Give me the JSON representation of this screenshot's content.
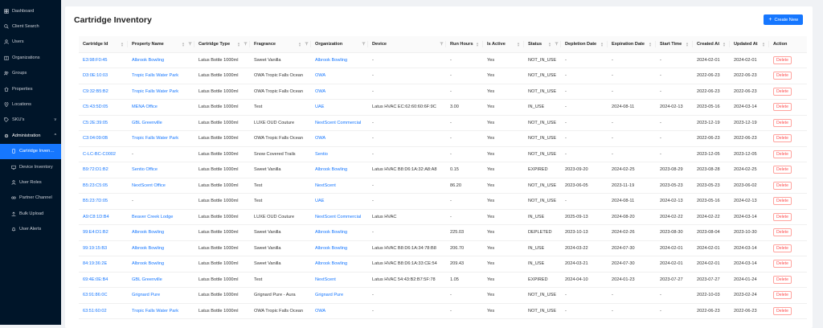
{
  "sidebar": {
    "items": [
      {
        "label": "Dashboard",
        "icon": "dashboard-icon"
      },
      {
        "label": "Client Search",
        "icon": "search-icon"
      },
      {
        "label": "Users",
        "icon": "user-icon"
      },
      {
        "label": "Organizations",
        "icon": "organization-icon"
      },
      {
        "label": "Groups",
        "icon": "group-icon"
      },
      {
        "label": "Properties",
        "icon": "home-icon"
      },
      {
        "label": "Locations",
        "icon": "location-icon"
      },
      {
        "label": "SKU's",
        "icon": "tag-icon"
      }
    ],
    "admin": {
      "label": "Administration",
      "icon": "settings-icon"
    },
    "admin_items": [
      {
        "label": "Cartridge Inven…",
        "icon": "cartridge-icon",
        "active": true
      },
      {
        "label": "Device Inventory",
        "icon": "device-icon"
      },
      {
        "label": "User Roles",
        "icon": "roles-icon"
      },
      {
        "label": "Partner Channel",
        "icon": "partner-icon"
      },
      {
        "label": "Bulk Upload",
        "icon": "upload-icon"
      },
      {
        "label": "User Alerts",
        "icon": "bell-icon"
      }
    ]
  },
  "page": {
    "title": "Cartridge Inventory",
    "create_label": "Create New"
  },
  "table": {
    "columns": [
      "Cartridge Id",
      "Property Name",
      "Cartridge Type",
      "Fragrance",
      "Organization",
      "Device",
      "Run Hours",
      "Is Active",
      "Status",
      "Depletion Date",
      "Expiration Date",
      "Start Time",
      "Created At",
      "Updated At",
      "Action"
    ],
    "delete_label": "Delete",
    "rows": [
      [
        "E3:98:F0:45",
        "Albrook Bowling",
        "Latus Bottle 1000ml",
        "Sweet Vanilla",
        "Albrook Bowling",
        "-",
        "-",
        "Yes",
        "NOT_IN_USE",
        "-",
        "-",
        "-",
        "2024-02-01",
        "2024-02-01"
      ],
      [
        "D3:0E:10:03",
        "Tropic Falls Water Park",
        "Latus Bottle 1000ml",
        "OWA Tropic Falls Ocean",
        "OWA",
        "-",
        "-",
        "Yes",
        "NOT_IN_USE",
        "-",
        "-",
        "-",
        "2022-06-23",
        "2022-06-23"
      ],
      [
        "C9:32:B5:B2",
        "Tropic Falls Water Park",
        "Latus Bottle 1000ml",
        "OWA Tropic Falls Ocean",
        "OWA",
        "-",
        "-",
        "Yes",
        "NOT_IN_USE",
        "-",
        "-",
        "-",
        "2022-06-23",
        "2022-06-23"
      ],
      [
        "C5:43:5D:05",
        "MENA Office",
        "Latus Bottle 1000ml",
        "Test",
        "UAE",
        "Latus HVAC EC:62:60:60:6F:9C",
        "3.00",
        "Yes",
        "IN_USE",
        "-",
        "2024-08-11",
        "2024-02-13",
        "2023-05-16",
        "2024-03-14"
      ],
      [
        "C5:2E:39:05",
        "GBL Greenville",
        "Latus Bottle 1000ml",
        "LUXE OUD Couture",
        "NextScent Commercial",
        "-",
        "-",
        "Yes",
        "NOT_IN_USE",
        "-",
        "-",
        "-",
        "2023-12-19",
        "2023-12-19"
      ],
      [
        "C3:04:09:0B",
        "Tropic Falls Water Park",
        "Latus Bottle 1000ml",
        "OWA Tropic Falls Ocean",
        "OWA",
        "-",
        "-",
        "Yes",
        "NOT_IN_USE",
        "-",
        "-",
        "-",
        "2022-06-23",
        "2022-06-23"
      ],
      [
        "C-LC-BC-C0002",
        "-",
        "Latus Bottle 1000ml",
        "Snow Covered Trails",
        "Sentio",
        "-",
        "-",
        "Yes",
        "NOT_IN_USE",
        "-",
        "-",
        "-",
        "2023-12-05",
        "2023-12-05"
      ],
      [
        "B9:72:D1:B2",
        "Sentio Office",
        "Latus Bottle 1000ml",
        "Sweet Vanilla",
        "Albrook Bowling",
        "Latus HVAC B8:D6:1A:32:A8:A8",
        "0.15",
        "Yes",
        "EXPIRED",
        "2023-09-20",
        "2024-02-25",
        "2023-08-29",
        "2023-08-28",
        "2024-02-25"
      ],
      [
        "B5:23:C5:05",
        "NextScent Office",
        "Latus Bottle 1000ml",
        "Test",
        "NextScent",
        "-",
        "86.20",
        "Yes",
        "NOT_IN_USE",
        "2023-06-05",
        "2023-11-19",
        "2023-05-23",
        "2023-05-23",
        "2023-06-02"
      ],
      [
        "B5:23:7D:05",
        "-",
        "Latus Bottle 1000ml",
        "Test",
        "UAE",
        "-",
        "-",
        "Yes",
        "NOT_IN_USE",
        "-",
        "2024-08-11",
        "2024-02-13",
        "2023-05-16",
        "2024-02-13"
      ],
      [
        "A9:C8:1D:B4",
        "Beaver Creek Lodge",
        "Latus Bottle 1000ml",
        "LUXE OUD Couture",
        "NextScent Commercial",
        "Latus HVAC",
        "-",
        "Yes",
        "IN_USE",
        "2025-09-13",
        "2024-08-20",
        "2024-02-22",
        "2024-02-22",
        "2024-03-14"
      ],
      [
        "99:E4:D1:B2",
        "Albrook Bowling",
        "Latus Bottle 1000ml",
        "Sweet Vanilla",
        "Albrook Bowling",
        "-",
        "225.03",
        "Yes",
        "DEPLETED",
        "2023-10-13",
        "2024-02-26",
        "2023-08-30",
        "2023-08-04",
        "2023-10-30"
      ],
      [
        "99:19:15:B3",
        "Albrook Bowling",
        "Latus Bottle 1000ml",
        "Sweet Vanilla",
        "Albrook Bowling",
        "Latus HVAC B8:D6:1A:34:78:B8",
        "206.70",
        "Yes",
        "IN_USE",
        "2024-03-22",
        "2024-07-30",
        "2024-02-01",
        "2024-02-01",
        "2024-03-14"
      ],
      [
        "84:19:36:2E",
        "Albrook Bowling",
        "Latus Bottle 1000ml",
        "Sweet Vanilla",
        "Albrook Bowling",
        "Latus HVAC B8:D6:1A:33:CE:54",
        "209.43",
        "Yes",
        "IN_USE",
        "2024-03-21",
        "2024-07-30",
        "2024-02-01",
        "2024-02-01",
        "2024-03-14"
      ],
      [
        "69:4E:0E:B4",
        "GBL Greenville",
        "Latus Bottle 1000ml",
        "Test",
        "NextScent",
        "Latus HVAC 54:43:B2:B7:5F:78",
        "1.05",
        "Yes",
        "EXPIRED",
        "2024-04-10",
        "2024-01-23",
        "2023-07-27",
        "2023-07-27",
        "2024-01-24"
      ],
      [
        "63:91:86:0C",
        "Grignard Pure",
        "Latus Bottle 1000ml",
        "Grignard Pure - Aura",
        "Grignard Pure",
        "-",
        "-",
        "Yes",
        "NOT_IN_USE",
        "-",
        "-",
        "-",
        "2022-10-03",
        "2023-02-24"
      ],
      [
        "63:51:60:02",
        "Tropic Falls Water Park",
        "Latus Bottle 1000ml",
        "OWA Tropic Falls Ocean",
        "OWA",
        "-",
        "-",
        "Yes",
        "NOT_IN_USE",
        "-",
        "-",
        "-",
        "2022-06-23",
        "2022-06-23"
      ]
    ]
  }
}
